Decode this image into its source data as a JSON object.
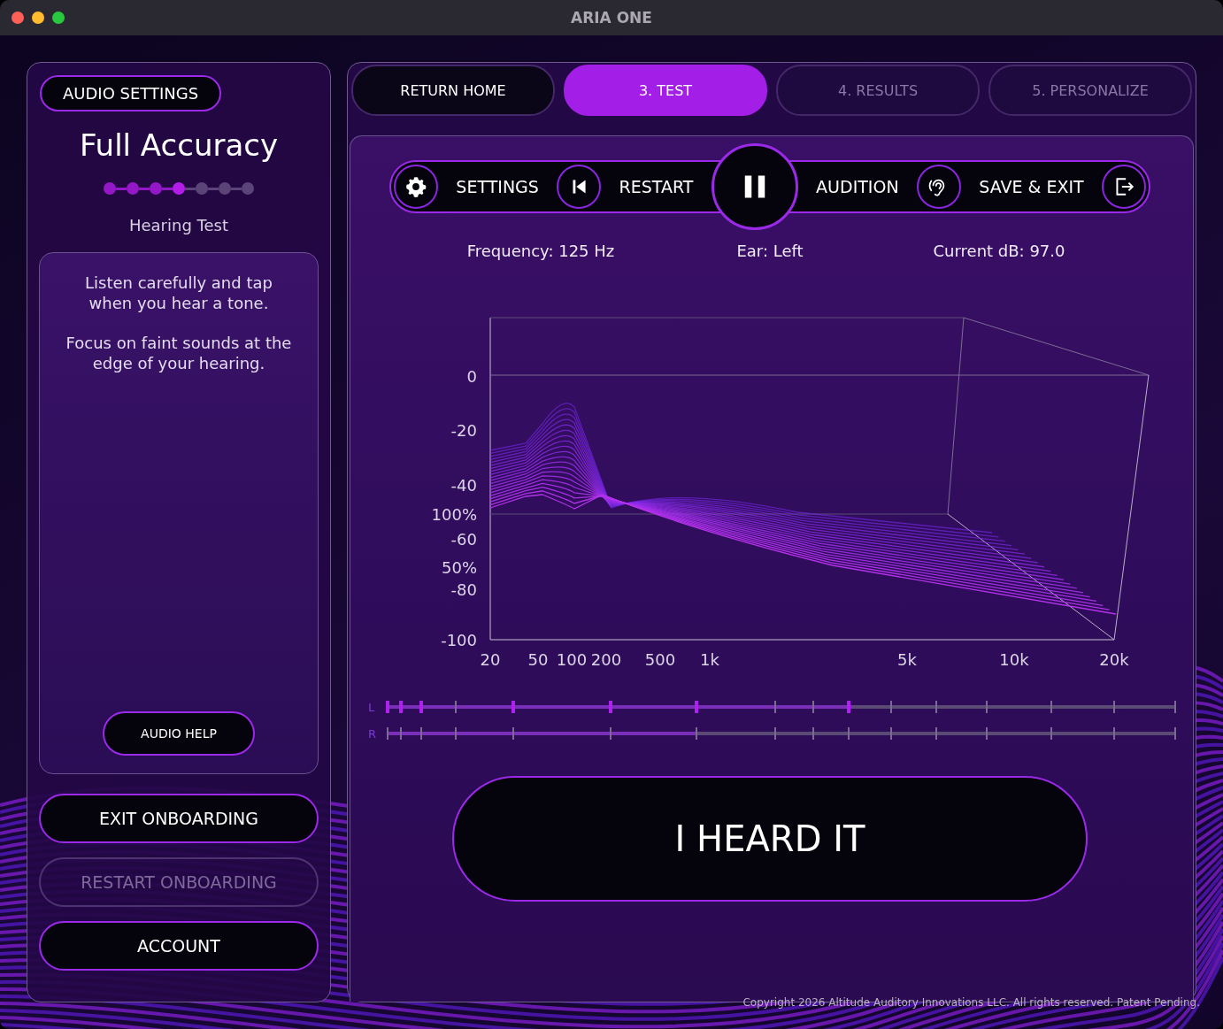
{
  "window": {
    "title": "ARIA ONE"
  },
  "sidebar": {
    "settings_button": "AUDIO SETTINGS",
    "heading": "Full Accuracy",
    "steps": [
      {
        "completed": true,
        "selected": false
      },
      {
        "completed": true,
        "selected": false
      },
      {
        "completed": true,
        "selected": false
      },
      {
        "completed": true,
        "selected": true
      },
      {
        "completed": false,
        "selected": false
      },
      {
        "completed": false,
        "selected": false
      },
      {
        "completed": false,
        "selected": false
      }
    ],
    "step_label": "Hearing Test",
    "instructions": [
      "Listen carefully and tap when you hear a tone.",
      "Focus on faint sounds at the edge of your hearing."
    ],
    "help_button": "AUDIO HELP",
    "buttons": [
      {
        "label": "EXIT ONBOARDING",
        "disabled": false
      },
      {
        "label": "RESTART ONBOARDING",
        "disabled": true
      },
      {
        "label": "ACCOUNT",
        "disabled": false
      }
    ]
  },
  "tabs": [
    {
      "label": "RETURN HOME",
      "selected": false,
      "disabled": false
    },
    {
      "label": "3. TEST",
      "selected": true,
      "disabled": false
    },
    {
      "label": "4. RESULTS",
      "selected": false,
      "disabled": true
    },
    {
      "label": "5. PERSONALIZE",
      "selected": false,
      "disabled": true
    }
  ],
  "controls": [
    {
      "kind": "gear"
    },
    {
      "kind": "label",
      "label": "SETTINGS"
    },
    {
      "kind": "skipback"
    },
    {
      "kind": "label",
      "label": "RESTART"
    },
    {
      "kind": "play",
      "playing": true
    },
    {
      "kind": "label",
      "label": "AUDITION"
    },
    {
      "kind": "ear"
    },
    {
      "kind": "label",
      "label": "SAVE & EXIT"
    },
    {
      "kind": "exit"
    }
  ],
  "readouts": [
    "Frequency: 125 Hz",
    "Ear: Left",
    "Current dB: 97.0"
  ],
  "chart": {
    "y_labels": [
      "0",
      "-20",
      "-40",
      "100%",
      "-60",
      "50%",
      "-80",
      "-100"
    ],
    "x_labels": [
      "20",
      "50",
      "100",
      "200",
      "500",
      "1k",
      "5k",
      "10k",
      "20k"
    ]
  },
  "tracks": [
    {
      "label": "L",
      "level": 0.59,
      "marks": [
        true,
        true,
        true,
        false,
        true,
        true,
        true,
        false,
        false,
        true,
        false,
        false,
        false,
        false,
        false,
        false
      ]
    },
    {
      "label": "R",
      "level": 0.39,
      "marks": [
        false,
        false,
        false,
        false,
        false,
        false,
        false,
        false,
        false,
        false,
        false,
        false,
        false,
        false,
        false,
        false
      ]
    }
  ],
  "heard_button": "I HEARD IT",
  "copyright": "Copyright 2026 Altitude Auditory Innovations LLC. All rights reserved. Patent Pending."
}
